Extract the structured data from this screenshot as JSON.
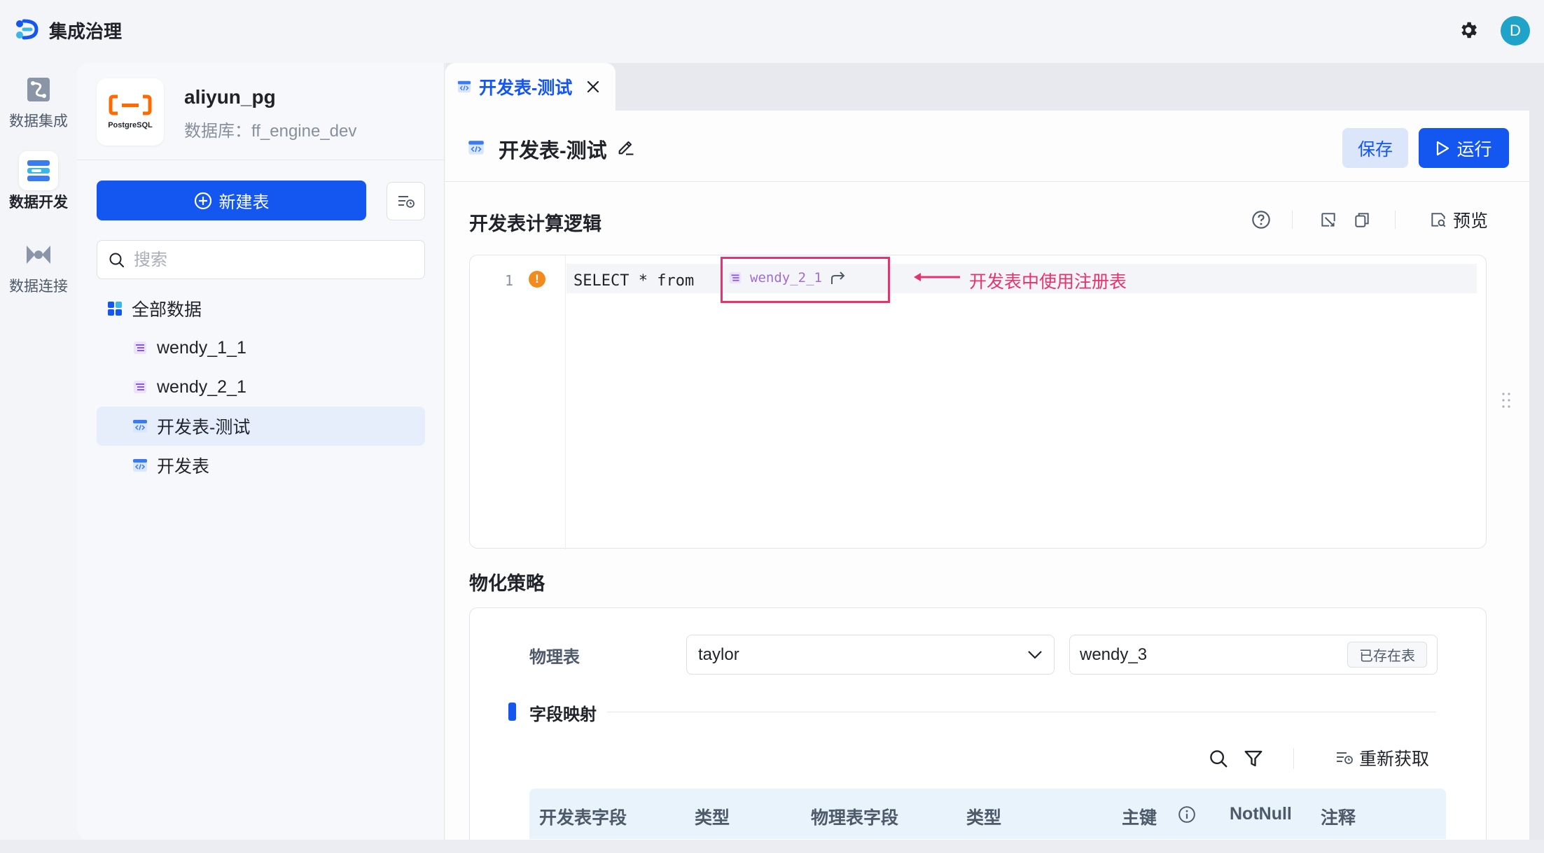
{
  "app": {
    "title": "集成治理",
    "avatar_initial": "D",
    "brand_color": "#1456f0"
  },
  "rail": {
    "items": [
      {
        "label": "数据集成",
        "icon": "data-integration-icon",
        "active": false
      },
      {
        "label": "数据开发",
        "icon": "data-development-icon",
        "active": true
      },
      {
        "label": "数据连接",
        "icon": "data-connection-icon",
        "active": false
      }
    ]
  },
  "sidebar": {
    "db_name": "aliyun_pg",
    "db_subtitle": "数据库：ff_engine_dev",
    "db_logo_text": "PostgreSQL",
    "new_table_label": "新建表",
    "search_placeholder": "搜索",
    "tree": {
      "root_label": "全部数据",
      "items": [
        {
          "label": "wendy_1_1",
          "type": "registered-table",
          "selected": false
        },
        {
          "label": "wendy_2_1",
          "type": "registered-table",
          "selected": false
        },
        {
          "label": "开发表-测试",
          "type": "dev-table",
          "selected": true
        },
        {
          "label": "开发表",
          "type": "dev-table",
          "selected": false
        }
      ]
    }
  },
  "tabs": [
    {
      "label": "开发表-测试",
      "active": true
    }
  ],
  "header": {
    "title": "开发表-测试",
    "save_label": "保存",
    "run_label": "运行"
  },
  "logic_section": {
    "title": "开发表计算逻辑",
    "preview_label": "预览",
    "editor": {
      "line_number": "1",
      "warning_glyph": "!",
      "sql_text": "SELECT * from",
      "table_ref": "wendy_2_1",
      "annotation": "开发表中使用注册表",
      "annotation_color": "#e6336e"
    }
  },
  "materialize_section": {
    "title": "物化策略",
    "physical_table_label": "物理表",
    "schema_value": "taylor",
    "table_value": "wendy_3",
    "exist_tag": "已存在表",
    "mapping_title": "字段映射",
    "refetch_label": "重新获取",
    "columns": [
      "开发表字段",
      "类型",
      "物理表字段",
      "类型",
      "主键",
      "NotNull",
      "注释"
    ]
  }
}
